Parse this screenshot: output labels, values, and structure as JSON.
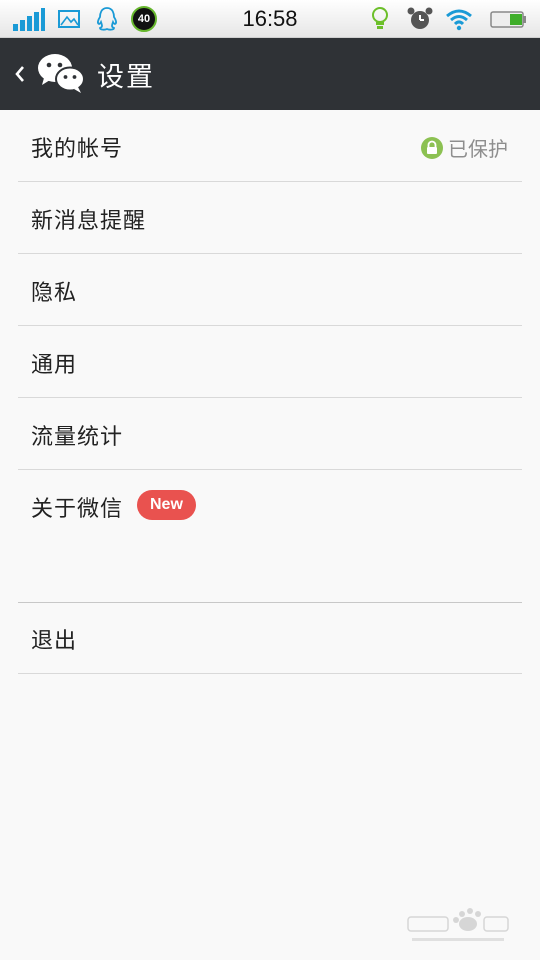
{
  "status_bar": {
    "time": "16:58",
    "badge_number": "40"
  },
  "header": {
    "title": "设置"
  },
  "settings": {
    "items": [
      {
        "label": "我的帐号",
        "status": "已保护"
      },
      {
        "label": "新消息提醒"
      },
      {
        "label": "隐私"
      },
      {
        "label": "通用"
      },
      {
        "label": "流量统计"
      },
      {
        "label": "关于微信",
        "badge": "New"
      }
    ]
  },
  "logout": {
    "label": "退出"
  },
  "colors": {
    "title_bar": "#2f3236",
    "badge": "#e9524f",
    "lock_icon": "#8cc152"
  }
}
